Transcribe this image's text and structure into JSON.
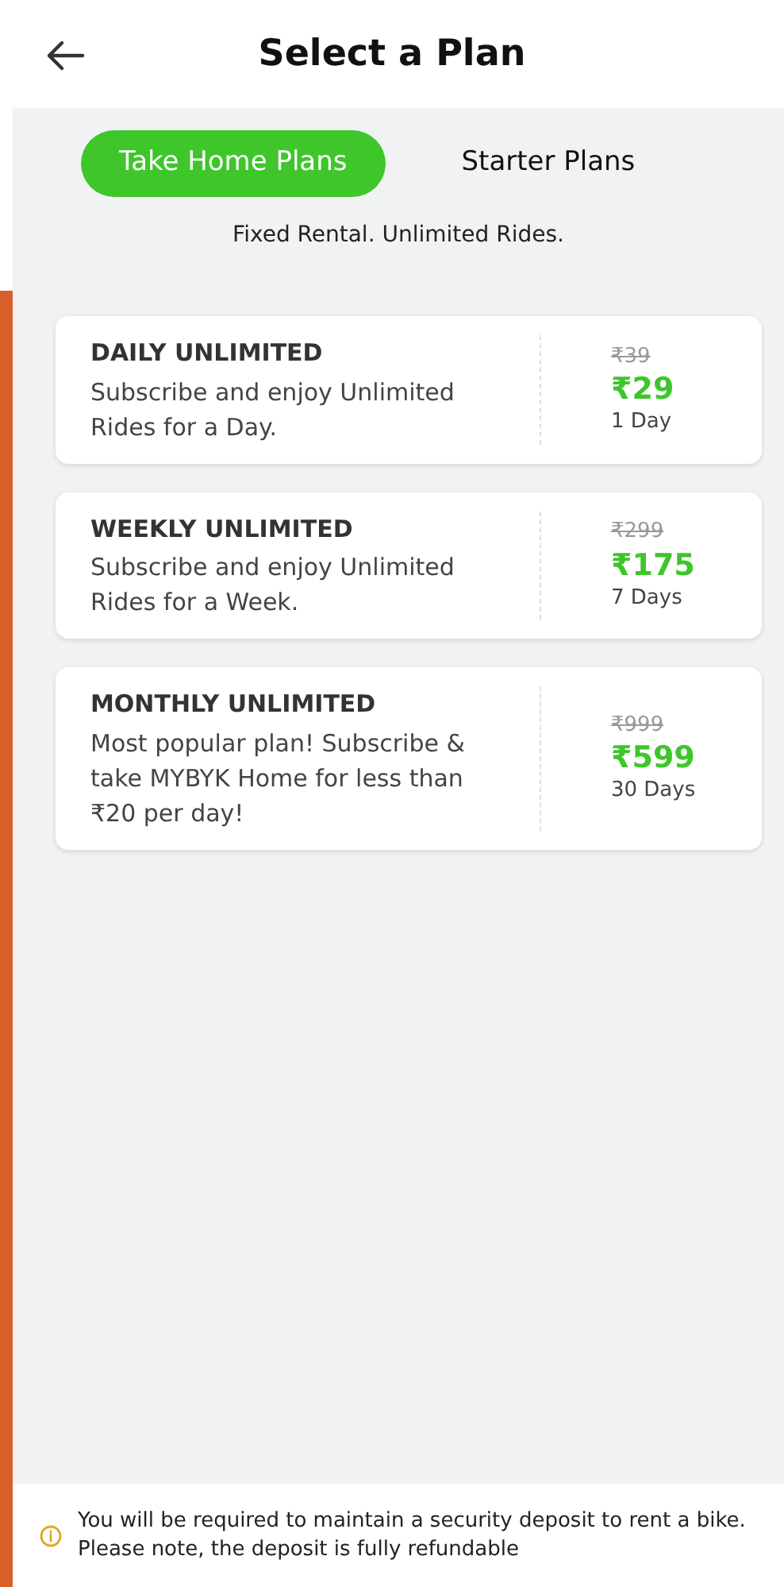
{
  "header": {
    "title": "Select a Plan"
  },
  "tabs": [
    {
      "label": "Take Home Plans",
      "selected": true
    },
    {
      "label": "Starter Plans",
      "selected": false
    }
  ],
  "subtitle": "Fixed Rental. Unlimited Rides.",
  "plans": [
    {
      "name": "DAILY UNLIMITED",
      "description": "Subscribe and enjoy Unlimited Rides for a Day.",
      "old_price": "₹39",
      "price": "₹29",
      "duration": "1 Day"
    },
    {
      "name": "WEEKLY UNLIMITED",
      "description": "Subscribe and enjoy Unlimited Rides for a Week.",
      "old_price": "₹299",
      "price": "₹175",
      "duration": "7 Days"
    },
    {
      "name": "MONTHLY UNLIMITED",
      "description": "Most popular plan! Subscribe & take MYBYK Home for less than ₹20 per day!",
      "old_price": "₹999",
      "price": "₹599",
      "duration": "30 Days"
    }
  ],
  "notice": "You will be required to maintain a security deposit to rent a bike. Please note, the deposit is fully refundable"
}
